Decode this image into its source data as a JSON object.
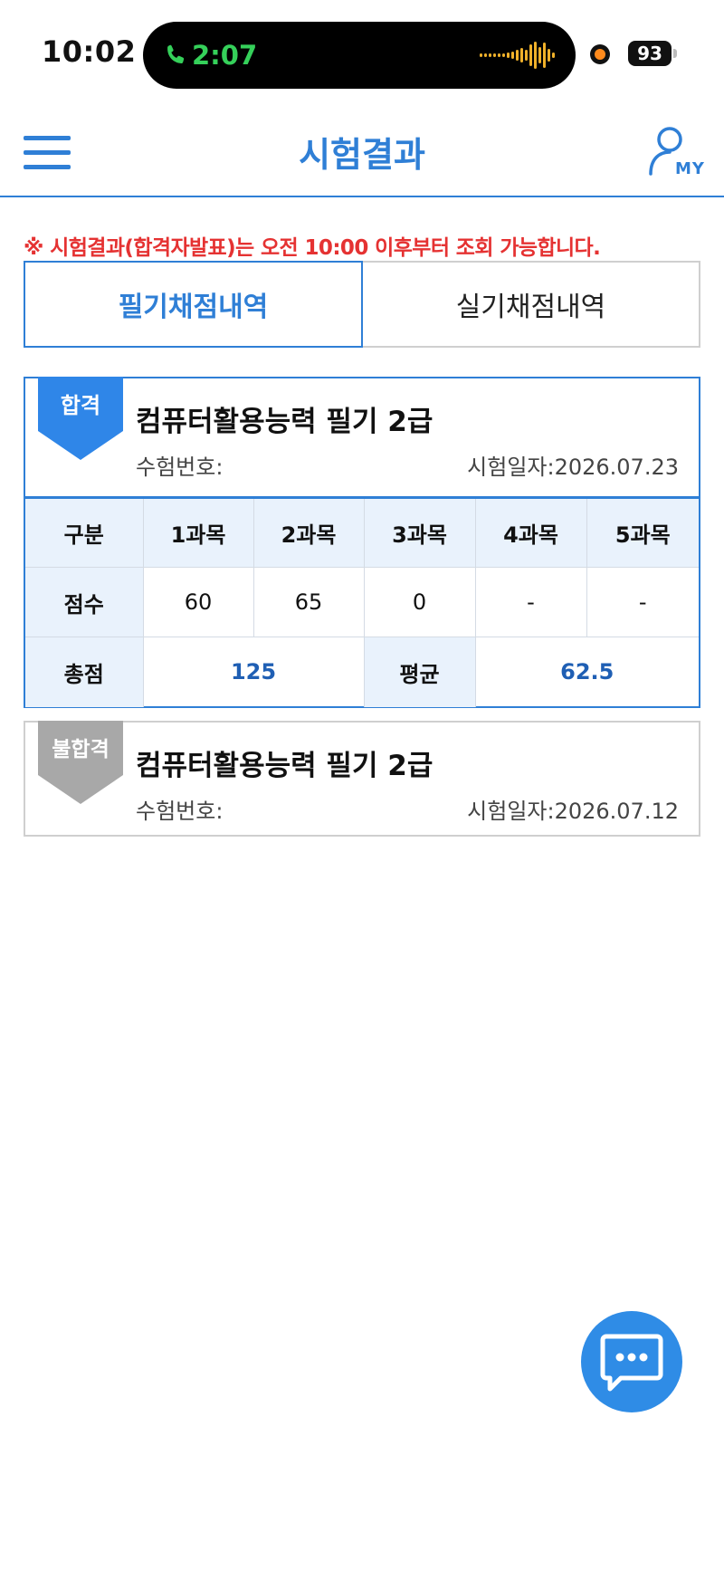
{
  "status_bar": {
    "time": "10:02",
    "call_duration": "2:07",
    "battery": "93"
  },
  "header": {
    "title": "시험결과",
    "menu_icon": "hamburger-menu-icon",
    "my_label": "MY",
    "my_icon": "user-icon"
  },
  "notice": "※ 시험결과(합격자발표)는 오전 10:00 이후부터 조회 가능합니다.",
  "tabs": [
    {
      "label": "필기채점내역",
      "active": true
    },
    {
      "label": "실기채점내역",
      "active": false
    }
  ],
  "results": [
    {
      "status": "합격",
      "status_color": "#2f86e8",
      "cert_name": "컴퓨터활용능력 필기 2급",
      "exam_no_label": "수험번호:",
      "exam_date": "시험일자:2026.07.23",
      "score_table": {
        "header_label": "구분",
        "subjects": [
          "1과목",
          "2과목",
          "3과목",
          "4과목",
          "5과목"
        ],
        "score_label": "점수",
        "scores": [
          "60",
          "65",
          "0",
          "-",
          "-"
        ],
        "total_label": "총점",
        "total": "125",
        "average_label": "평균",
        "average": "62.5"
      }
    },
    {
      "status": "불합격",
      "status_color": "#a8a8a8",
      "cert_name": "컴퓨터활용능력 필기 2급",
      "exam_no_label": "수험번호:",
      "exam_date": "시험일자:2026.07.12"
    }
  ],
  "colors": {
    "accent": "#2f7fd6",
    "notice": "#e53232",
    "table_header_bg": "#e9f2fc",
    "score_value": "#1f5fb4"
  },
  "chat_icon": "chat-bubble-icon"
}
